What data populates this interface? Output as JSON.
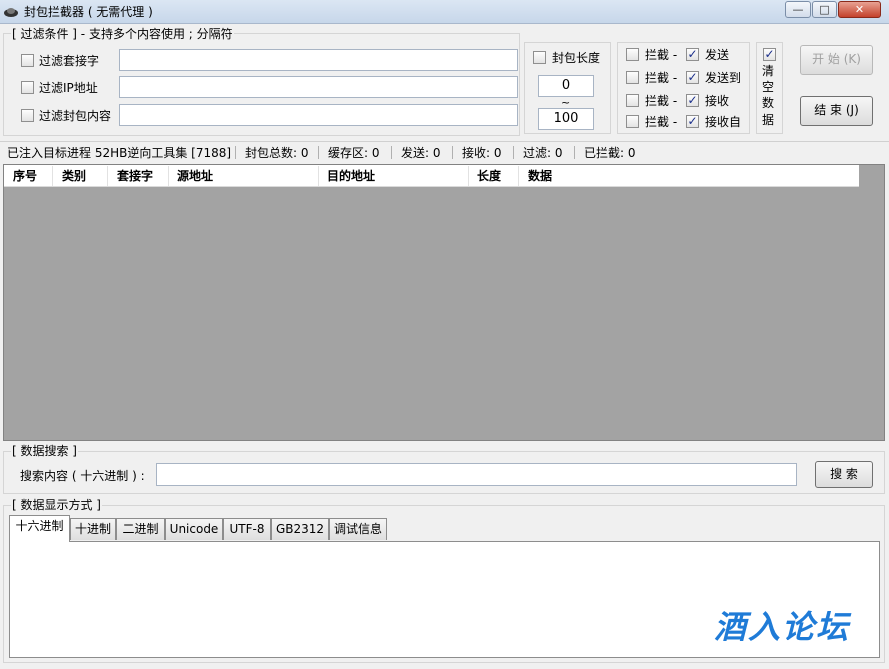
{
  "window": {
    "title": "封包拦截器 ( 无需代理 )",
    "controls": {
      "minimize": "—",
      "maximize": "□",
      "close": "✕"
    }
  },
  "filters": {
    "group_title": "[ 过滤条件 ] - 支持多个内容使用 ; 分隔符",
    "socket": {
      "label": "过滤套接字",
      "checked": false,
      "value": ""
    },
    "ip": {
      "label": "过滤IP地址",
      "checked": false,
      "value": ""
    },
    "content": {
      "label": "过滤封包内容",
      "checked": false,
      "value": ""
    }
  },
  "length_filter": {
    "label": "封包长度",
    "checked": false,
    "min": "0",
    "separator": "~",
    "max": "100"
  },
  "intercept": {
    "rows": [
      {
        "intercept_label": "拦截 -",
        "intercept_checked": false,
        "type_label": "发送",
        "type_checked": true
      },
      {
        "intercept_label": "拦截 -",
        "intercept_checked": false,
        "type_label": "发送到",
        "type_checked": true
      },
      {
        "intercept_label": "拦截 -",
        "intercept_checked": false,
        "type_label": "接收",
        "type_checked": true
      },
      {
        "intercept_label": "拦截 -",
        "intercept_checked": false,
        "type_label": "接收自",
        "type_checked": true
      }
    ]
  },
  "clear_data": {
    "chars": [
      "清",
      "空",
      "数",
      "据"
    ],
    "checked": true
  },
  "buttons": {
    "start": "开 始 (K)",
    "stop": "结 束 (J)",
    "search": "搜 索"
  },
  "status": {
    "process": "已注入目标进程 52HB逆向工具集 [7188]",
    "total": "封包总数:  0",
    "buffer": "缓存区:  0",
    "sent": "发送:  0",
    "received": "接收:  0",
    "filtered": "过滤:  0",
    "intercepted": "已拦截:  0"
  },
  "table": {
    "columns": [
      "序号",
      "类别",
      "套接字",
      "源地址",
      "目的地址",
      "长度",
      "数据"
    ],
    "rows": []
  },
  "search": {
    "group_title": "[ 数据搜索 ]",
    "label": "搜索内容 ( 十六进制 ) :",
    "value": ""
  },
  "display": {
    "group_title": "[ 数据显示方式 ]",
    "tabs": [
      "十六进制",
      "十进制",
      "二进制",
      "Unicode",
      "UTF-8",
      "GB2312",
      "调试信息"
    ],
    "active_tab": 0,
    "content": ""
  },
  "watermark": "酒入论坛",
  "colors": {
    "grid_bg": "#a3a3a3",
    "watermark": "#1f7bd7",
    "checkmark": "#1a2e8a"
  }
}
